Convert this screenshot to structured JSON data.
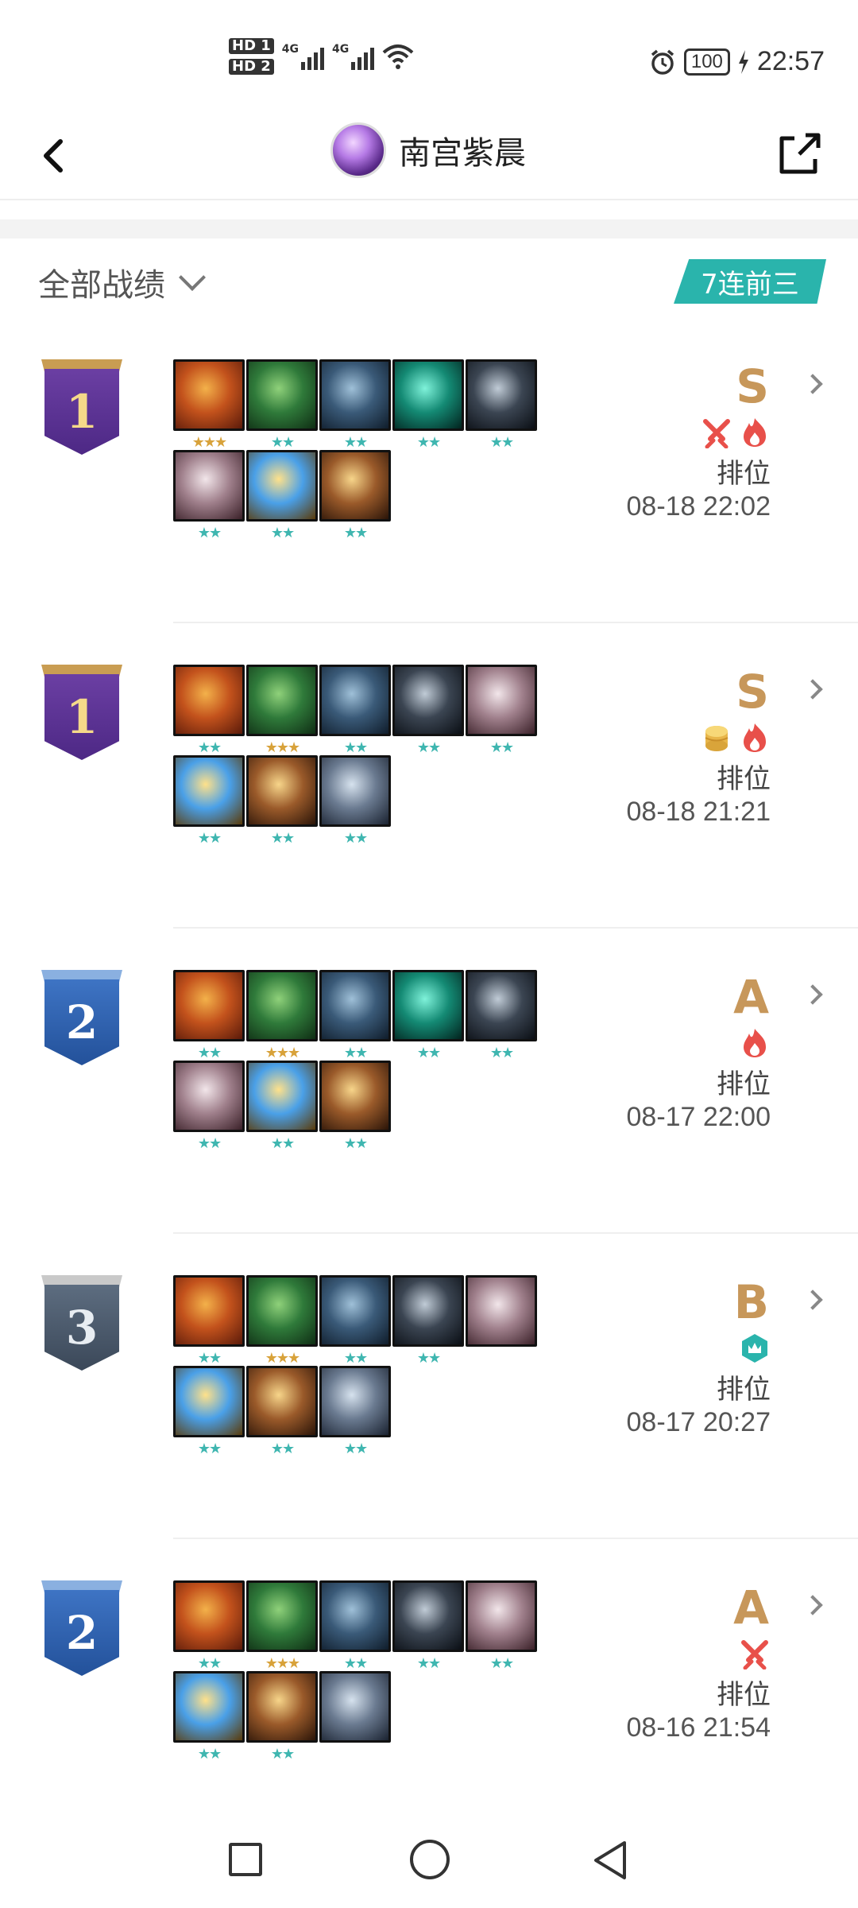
{
  "status_bar": {
    "hd1": "HD 1",
    "hd2": "HD 2",
    "net1": "4G",
    "net2": "4G",
    "battery": "100",
    "time": "22:57"
  },
  "header": {
    "nickname": "南宫紫晨"
  },
  "filter": {
    "label": "全部战绩",
    "streak_badge": "7连前三"
  },
  "matches": [
    {
      "rank": "1",
      "rank_tier": "r1",
      "grade": "S",
      "mode": "排位",
      "time": "08-18 22:02",
      "tags": [
        "crossed-swords-icon",
        "flame-icon"
      ],
      "champions": [
        {
          "icon": "champion-red-hair-icon",
          "stars": "★★★",
          "tier": "gold"
        },
        {
          "icon": "champion-green-brute-icon",
          "stars": "★★",
          "tier": "teal"
        },
        {
          "icon": "champion-dark-blue-icon",
          "stars": "★★",
          "tier": "teal"
        },
        {
          "icon": "champion-teal-specter-icon",
          "stars": "★★",
          "tier": "teal"
        },
        {
          "icon": "champion-dark-knight-icon",
          "stars": "★★",
          "tier": "teal"
        },
        {
          "icon": "champion-white-hair-icon",
          "stars": "★★",
          "tier": "teal"
        },
        {
          "icon": "champion-golden-blue-icon",
          "stars": "★★",
          "tier": "teal"
        },
        {
          "icon": "champion-bearded-warrior-icon",
          "stars": "★★",
          "tier": "teal"
        }
      ]
    },
    {
      "rank": "1",
      "rank_tier": "r1",
      "grade": "S",
      "mode": "排位",
      "time": "08-18 21:21",
      "tags": [
        "coin-stack-icon",
        "flame-icon"
      ],
      "champions": [
        {
          "icon": "champion-red-hair-icon",
          "stars": "★★",
          "tier": "teal"
        },
        {
          "icon": "champion-green-brute-icon",
          "stars": "★★★",
          "tier": "gold"
        },
        {
          "icon": "champion-dark-blue-icon",
          "stars": "★★",
          "tier": "teal"
        },
        {
          "icon": "champion-dark-knight-icon",
          "stars": "★★",
          "tier": "teal"
        },
        {
          "icon": "champion-white-hair-icon",
          "stars": "★★",
          "tier": "teal"
        },
        {
          "icon": "champion-golden-blue-icon",
          "stars": "★★",
          "tier": "teal"
        },
        {
          "icon": "champion-bearded-warrior-icon",
          "stars": "★★",
          "tier": "teal"
        },
        {
          "icon": "champion-grey-warrior-icon",
          "stars": "★★",
          "tier": "teal"
        }
      ]
    },
    {
      "rank": "2",
      "rank_tier": "r2",
      "grade": "A",
      "mode": "排位",
      "time": "08-17 22:00",
      "tags": [
        "flame-icon"
      ],
      "champions": [
        {
          "icon": "champion-red-hair-icon",
          "stars": "★★",
          "tier": "teal"
        },
        {
          "icon": "champion-green-brute-icon",
          "stars": "★★★",
          "tier": "gold"
        },
        {
          "icon": "champion-dark-blue-icon",
          "stars": "★★",
          "tier": "teal"
        },
        {
          "icon": "champion-teal-specter-icon",
          "stars": "★★",
          "tier": "teal"
        },
        {
          "icon": "champion-dark-knight-icon",
          "stars": "★★",
          "tier": "teal"
        },
        {
          "icon": "champion-white-hair-icon",
          "stars": "★★",
          "tier": "teal"
        },
        {
          "icon": "champion-golden-blue-icon",
          "stars": "★★",
          "tier": "teal"
        },
        {
          "icon": "champion-bearded-warrior-icon",
          "stars": "★★",
          "tier": "teal"
        }
      ]
    },
    {
      "rank": "3",
      "rank_tier": "r3",
      "grade": "B",
      "mode": "排位",
      "time": "08-17 20:27",
      "tags": [
        "hexagon-crown-icon"
      ],
      "champions": [
        {
          "icon": "champion-red-hair-icon",
          "stars": "★★",
          "tier": "teal"
        },
        {
          "icon": "champion-green-brute-icon",
          "stars": "★★★",
          "tier": "gold"
        },
        {
          "icon": "champion-dark-blue-icon",
          "stars": "★★",
          "tier": "teal"
        },
        {
          "icon": "champion-dark-knight-icon",
          "stars": "★★",
          "tier": "teal"
        },
        {
          "icon": "champion-white-hair-icon",
          "stars": "",
          "tier": "teal"
        },
        {
          "icon": "champion-golden-blue-icon",
          "stars": "★★",
          "tier": "teal"
        },
        {
          "icon": "champion-bearded-warrior-icon",
          "stars": "★★",
          "tier": "teal"
        },
        {
          "icon": "champion-grey-warrior-icon",
          "stars": "★★",
          "tier": "teal"
        }
      ]
    },
    {
      "rank": "2",
      "rank_tier": "r2",
      "grade": "A",
      "mode": "排位",
      "time": "08-16 21:54",
      "tags": [
        "crossed-swords-icon"
      ],
      "champions": [
        {
          "icon": "champion-red-hair-icon",
          "stars": "★★",
          "tier": "teal"
        },
        {
          "icon": "champion-green-brute-icon",
          "stars": "★★★",
          "tier": "gold"
        },
        {
          "icon": "champion-dark-blue-icon",
          "stars": "★★",
          "tier": "teal"
        },
        {
          "icon": "champion-dark-knight-icon",
          "stars": "★★",
          "tier": "teal"
        },
        {
          "icon": "champion-white-hair-icon",
          "stars": "★★",
          "tier": "teal"
        },
        {
          "icon": "champion-golden-blue-icon",
          "stars": "★★",
          "tier": "teal"
        },
        {
          "icon": "champion-bearded-warrior-icon",
          "stars": "★★",
          "tier": "teal"
        },
        {
          "icon": "champion-grey-warrior-icon",
          "stars": "",
          "tier": "teal"
        }
      ]
    }
  ],
  "colors": {
    "accent_teal": "#2ab4ac",
    "grade_gold": "#c7975a",
    "tag_red": "#e8504a",
    "tag_gold": "#e8b64a",
    "tag_teal": "#2ab4ac"
  }
}
